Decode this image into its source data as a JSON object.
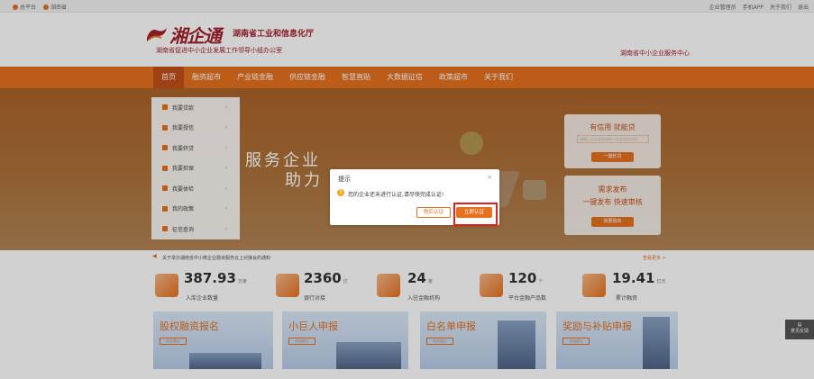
{
  "topbar": {
    "left": [
      {
        "label": "总平台",
        "color": "#e6711f"
      },
      {
        "label": "湖南省",
        "color": "#e6711f"
      }
    ],
    "right": [
      "企业管理员",
      "手机APP",
      "关于我们",
      "退出"
    ]
  },
  "header": {
    "logo_script": "湘企通",
    "org1": "湖南省工业和信息化厅",
    "org2": "湖南省促进中小企业发展工作领导小组办公室",
    "service": "湖南省中小企业服务中心"
  },
  "nav": {
    "items": [
      "首页",
      "融资超市",
      "产业链金融",
      "供应链金融",
      "智慧直贴",
      "大数据征信",
      "政策超市",
      "关于我们"
    ]
  },
  "side_menu": {
    "items": [
      "我要贷款",
      "我要授信",
      "我要转贷",
      "我要担保",
      "我要体检",
      "我的政策",
      "征信查询"
    ],
    "arrow": "›"
  },
  "banner": {
    "slogan1": "服务企业",
    "slogan2": "助力"
  },
  "cards": {
    "card1_title": "有信用 就能贷",
    "card1_placeholder": "请输入企业名称或统一社会信用代码",
    "card1_button": "一键秒贷",
    "card2_title1": "需求发布",
    "card2_title2": "一键发布 快速审核",
    "card2_button": "我要融资"
  },
  "notice": {
    "text": "关于举办湖南省中小微企业融资服务云上对接会的通知",
    "more": "查看更多 >"
  },
  "stats": [
    {
      "value": "387.93",
      "unit": "万家",
      "label": "入库企业数量"
    },
    {
      "value": "2360",
      "unit": "亿",
      "label": "银行对接"
    },
    {
      "value": "24",
      "unit": "家",
      "label": "入驻金融机构"
    },
    {
      "value": "120",
      "unit": "个",
      "label": "平台金融产品数"
    },
    {
      "value": "19.41",
      "unit": "亿元",
      "label": "累计融资"
    }
  ],
  "promos": [
    {
      "title": "股权融资报名",
      "button": "点击进入"
    },
    {
      "title": "小巨人申报",
      "button": "点击进入"
    },
    {
      "title": "白名单申报",
      "button": "点击进入"
    },
    {
      "title": "奖励与补贴申报",
      "button": "点击进入"
    }
  ],
  "modal": {
    "title": "提示",
    "close": "×",
    "icon": "!",
    "message": "您的企业还未进行认证,请尽快完成认证!",
    "later": "稍后认证",
    "now": "立即认证"
  },
  "feedback": "意见反馈",
  "colors": {
    "accent": "#e6711f",
    "brand": "#a4222c",
    "highlight": "#e21d1d"
  }
}
